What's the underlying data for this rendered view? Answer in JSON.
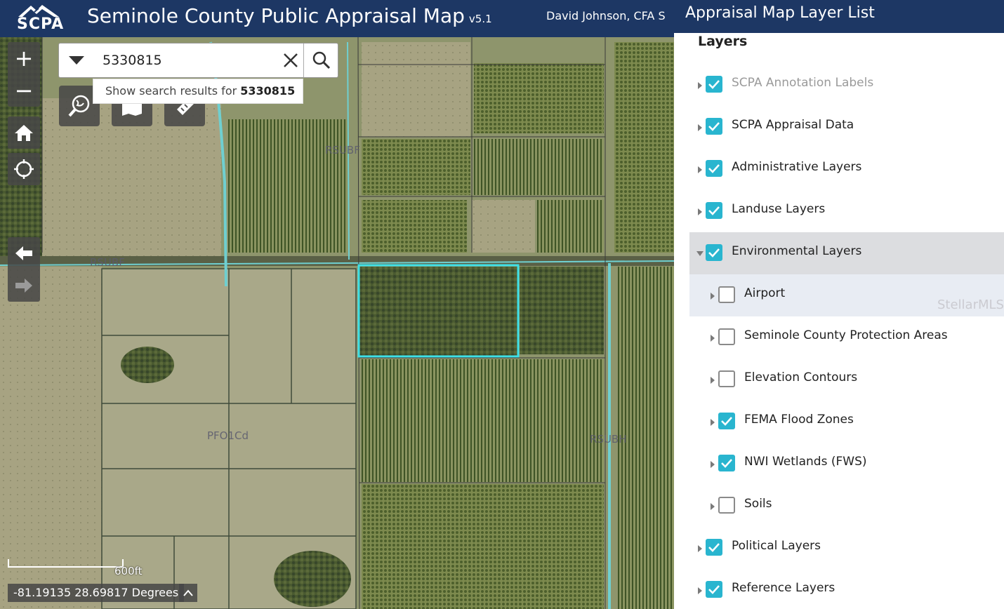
{
  "header": {
    "logo_text": "SCPA",
    "title": "Seminole County Public Appraisal Map",
    "version": "v5.1",
    "user": "David Johnson, CFA  S"
  },
  "search": {
    "value": "5330815",
    "suggestion_prefix": "Show search results for ",
    "suggestion_term": "5330815"
  },
  "map": {
    "labels": {
      "rsubf": "RSUBF",
      "rsubf_top": "RSUBF",
      "rsubh": "RSUBH",
      "pfo1cd": "PFO1Cd"
    },
    "scale_label": "600ft",
    "coordinates": "-81.19135 28.69817 Degrees",
    "parcel_highlight_color": "#3ee0e6"
  },
  "panel": {
    "title": "Appraisal Map Layer List",
    "subtitle": "Layers",
    "watermark": "StellarMLS",
    "layers": [
      {
        "label": "SCPA Annotation Labels",
        "checked": true,
        "expanded": false,
        "dim": true
      },
      {
        "label": "SCPA Appraisal Data",
        "checked": true,
        "expanded": false
      },
      {
        "label": "Administrative Layers",
        "checked": true,
        "expanded": false
      },
      {
        "label": "Landuse Layers",
        "checked": true,
        "expanded": false
      },
      {
        "label": "Environmental Layers",
        "checked": true,
        "expanded": true,
        "children": [
          {
            "label": "Airport",
            "checked": false
          },
          {
            "label": "Seminole County Protection Areas",
            "checked": false
          },
          {
            "label": "Elevation Contours",
            "checked": false
          },
          {
            "label": "FEMA Flood Zones",
            "checked": true
          },
          {
            "label": "NWI Wetlands (FWS)",
            "checked": true
          },
          {
            "label": "Soils",
            "checked": false
          }
        ]
      },
      {
        "label": "Political Layers",
        "checked": true,
        "expanded": false
      },
      {
        "label": "Reference Layers",
        "checked": true,
        "expanded": false
      }
    ],
    "accent_color": "#29b5cf",
    "header_color": "#1d3764"
  }
}
